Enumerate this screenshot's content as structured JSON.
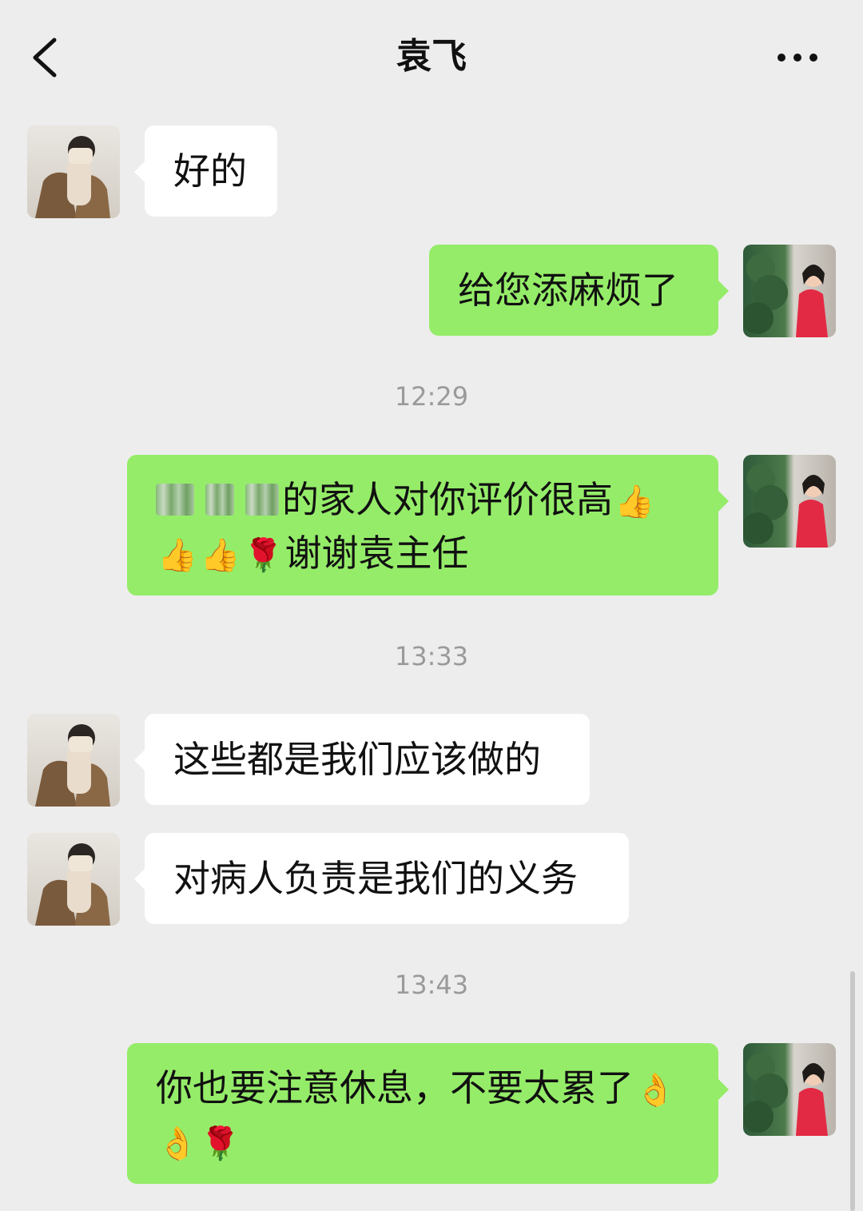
{
  "header": {
    "title": "袁飞",
    "back_icon": "chevron-left-icon",
    "more_icon": "more-dots-icon"
  },
  "colors": {
    "background": "#ededed",
    "outgoing_bubble": "#95ec69",
    "incoming_bubble": "#ffffff",
    "timestamp": "#9a9a9a"
  },
  "messages": [
    {
      "sender": "contact",
      "text": "好的"
    },
    {
      "sender": "me",
      "text": "给您添麻烦了"
    },
    {
      "type": "timestamp",
      "text": "12:29"
    },
    {
      "sender": "me",
      "line1": "的家人对你评价很高",
      "line2": "谢谢袁主任",
      "emoji": [
        "👍",
        "👍",
        "👍",
        "🌹"
      ],
      "redacted": true
    },
    {
      "type": "timestamp",
      "text": "13:33"
    },
    {
      "sender": "contact",
      "text": "这些都是我们应该做的"
    },
    {
      "sender": "contact",
      "text": "对病人负责是我们的义务"
    },
    {
      "type": "timestamp",
      "text": "13:43"
    },
    {
      "sender": "me",
      "line1": "你也要注意休息，不要太累了",
      "emoji": [
        "👌",
        "👌",
        "🌹"
      ]
    }
  ]
}
